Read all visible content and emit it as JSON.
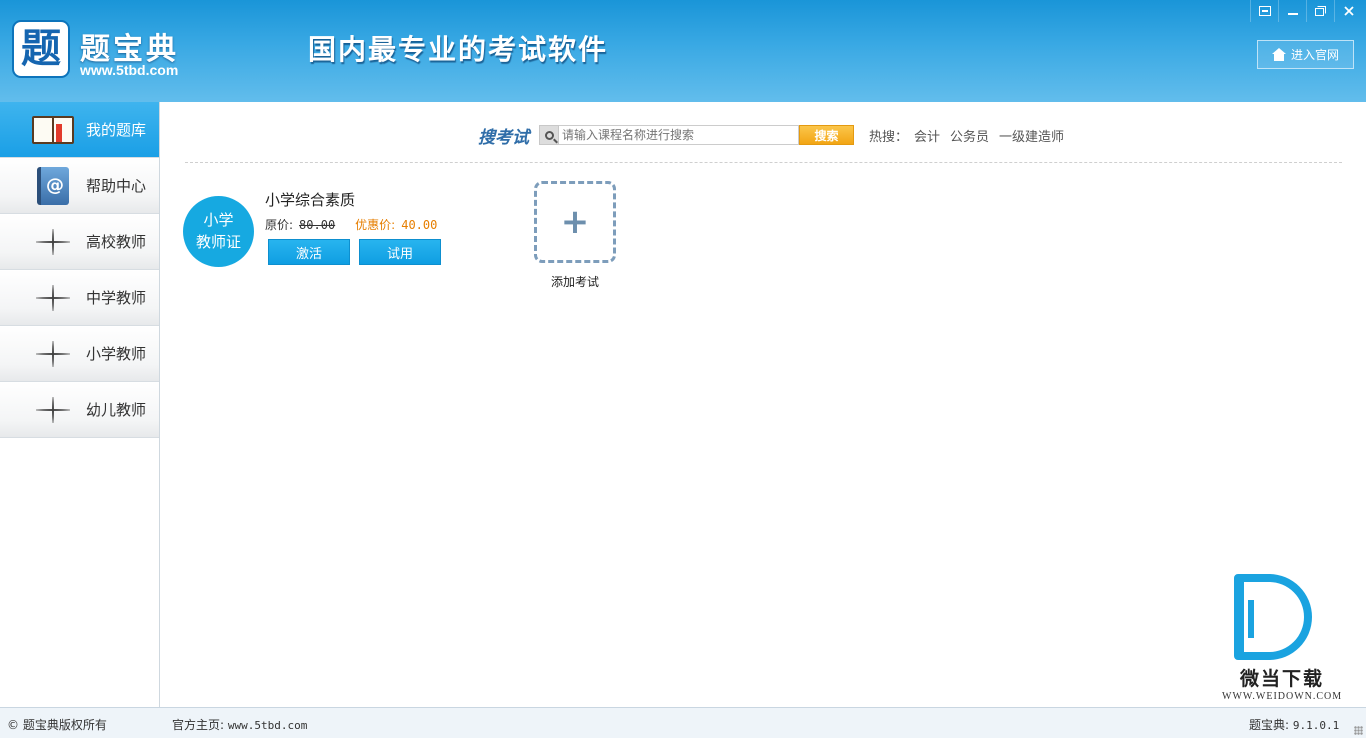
{
  "header": {
    "logo_glyph": "题",
    "logo_name": "题宝典",
    "logo_url": "www.5tbd.com",
    "slogan": "国内最专业的考试软件",
    "site_button": "进入官网",
    "window_controls": [
      "skin-icon",
      "minimize-icon",
      "restore-icon",
      "close-icon"
    ]
  },
  "sidebar": {
    "items": [
      {
        "label": "我的题库",
        "icon": "book-icon",
        "active": true
      },
      {
        "label": "帮助中心",
        "icon": "address-book-icon",
        "active": false
      },
      {
        "label": "高校教师",
        "icon": "sparkle-icon",
        "active": false
      },
      {
        "label": "中学教师",
        "icon": "sparkle-icon",
        "active": false
      },
      {
        "label": "小学教师",
        "icon": "sparkle-icon",
        "active": false
      },
      {
        "label": "幼儿教师",
        "icon": "sparkle-icon",
        "active": false
      }
    ]
  },
  "search": {
    "title": "搜考试",
    "placeholder": "请输入课程名称进行搜索",
    "button": "搜索",
    "hot_label": "热搜：",
    "hot_keywords": [
      "会计",
      "公务员",
      "一级建造师"
    ]
  },
  "exam": {
    "badge_line1": "小学",
    "badge_line2": "教师证",
    "name": "小学综合素质",
    "original_price_label": "原价:",
    "original_price": "80.00",
    "discount_price_label": "优惠价:",
    "discount_price": "40.00",
    "activate_button": "激活",
    "trial_button": "试用"
  },
  "add_exam": {
    "symbol": "+",
    "label": "添加考试"
  },
  "watermark": {
    "text": "微当下载",
    "url": "WWW.WEIDOWN.COM"
  },
  "statusbar": {
    "copyright": "© 题宝典版权所有",
    "homepage_label": "官方主页:",
    "homepage_url": "www.5tbd.com",
    "version_label": "题宝典:",
    "version": "9.1.0.1"
  },
  "colors": {
    "header_blue": "#1a95d8",
    "active_nav": "#1a9fe6",
    "button_blue": "#0f9ee2",
    "search_orange": "#f2a514",
    "discount_orange": "#e67e00"
  }
}
